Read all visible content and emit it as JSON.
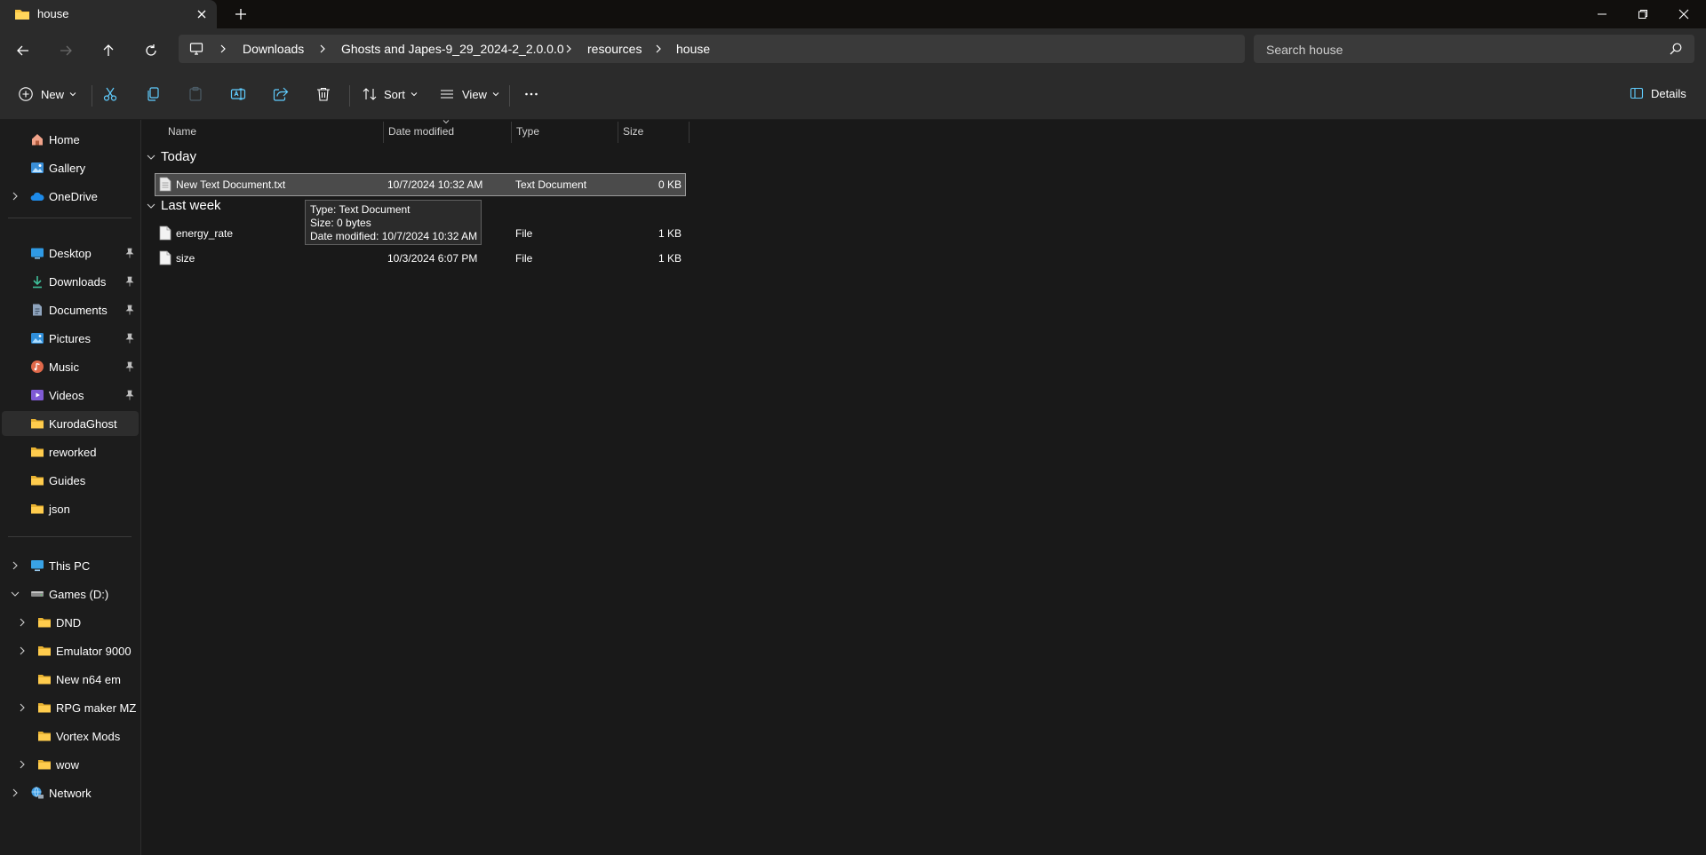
{
  "tab": {
    "title": "house"
  },
  "address": {
    "crumbs": [
      "Downloads",
      "Ghosts and Japes-9_29_2024-2_2.0.0.0",
      "resources",
      "house"
    ]
  },
  "search": {
    "placeholder": "Search house"
  },
  "commands": {
    "new_label": "New",
    "sort_label": "Sort",
    "view_label": "View",
    "details_label": "Details"
  },
  "sidebar": {
    "quick": [
      {
        "label": "Home",
        "icon": "home-icon"
      },
      {
        "label": "Gallery",
        "icon": "gallery-icon"
      },
      {
        "label": "OneDrive",
        "icon": "cloud-icon",
        "expandable": true
      }
    ],
    "pinned": [
      {
        "label": "Desktop",
        "icon": "desktop-icon",
        "pinned": true
      },
      {
        "label": "Downloads",
        "icon": "download-icon",
        "pinned": true
      },
      {
        "label": "Documents",
        "icon": "document-icon",
        "pinned": true
      },
      {
        "label": "Pictures",
        "icon": "picture-icon",
        "pinned": true
      },
      {
        "label": "Music",
        "icon": "music-icon",
        "pinned": true
      },
      {
        "label": "Videos",
        "icon": "video-icon",
        "pinned": true
      },
      {
        "label": "KurodaGhost",
        "icon": "folder-icon",
        "selected": true
      },
      {
        "label": "reworked",
        "icon": "folder-icon"
      },
      {
        "label": "Guides",
        "icon": "folder-icon"
      },
      {
        "label": "json",
        "icon": "folder-icon"
      }
    ],
    "tree": [
      {
        "label": "This PC",
        "icon": "computer-icon",
        "level": 0,
        "expander": "collapsed"
      },
      {
        "label": "Games (D:)",
        "icon": "drive-icon",
        "level": 0,
        "expander": "expanded"
      },
      {
        "label": "DND",
        "icon": "folder-icon",
        "level": 1,
        "expander": "collapsed"
      },
      {
        "label": "Emulator 9000",
        "icon": "folder-icon",
        "level": 1,
        "expander": "collapsed"
      },
      {
        "label": "New n64 em",
        "icon": "folder-icon",
        "level": 1,
        "expander": "none"
      },
      {
        "label": "RPG maker MZ",
        "icon": "folder-icon",
        "level": 1,
        "expander": "collapsed"
      },
      {
        "label": "Vortex Mods",
        "icon": "folder-icon",
        "level": 1,
        "expander": "none"
      },
      {
        "label": "wow",
        "icon": "folder-icon",
        "level": 1,
        "expander": "collapsed"
      },
      {
        "label": "Network",
        "icon": "network-icon",
        "level": 0,
        "expander": "collapsed"
      }
    ]
  },
  "columns": {
    "name": "Name",
    "date": "Date modified",
    "type": "Type",
    "size": "Size"
  },
  "groups": [
    {
      "label": "Today",
      "files": [
        {
          "name": "New Text Document.txt",
          "date": "10/7/2024 10:32 AM",
          "type": "Text Document",
          "size": "0 KB",
          "selected": true,
          "icon": "text-file-icon"
        }
      ]
    },
    {
      "label": "Last week",
      "files": [
        {
          "name": "energy_rate",
          "date": "",
          "type": "File",
          "size": "1 KB",
          "icon": "file-icon"
        },
        {
          "name": "size",
          "date": "10/3/2024 6:07 PM",
          "type": "File",
          "size": "1 KB",
          "icon": "file-icon"
        }
      ]
    }
  ],
  "tooltip": {
    "line1": "Type: Text Document",
    "line2": "Size: 0 bytes",
    "line3": "Date modified: 10/7/2024 10:32 AM"
  }
}
